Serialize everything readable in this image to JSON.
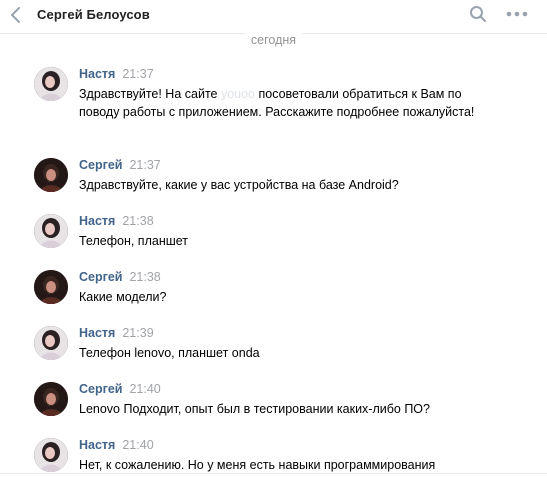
{
  "header": {
    "title": "Сергей Белоусов",
    "back_icon": "chevron-left-icon",
    "search_icon": "search-icon",
    "more_icon": "more-dots-icon"
  },
  "date_divider": "сегодня",
  "colors": {
    "author": "#42648b",
    "time": "#a0a3a8",
    "divider_text": "#939393",
    "border": "#e7e8ec"
  },
  "messages": [
    {
      "author": "Настя",
      "time": "21:37",
      "text_before": "Здравствуйте! На сайте ",
      "text_redacted": "youoo",
      "text_after": " посоветовали обратиться к Вам по поводу работы с приложением. Расскажите подробнее пожалуйста!"
    },
    {
      "author": "Сергей",
      "time": "21:37",
      "text": "Здравствуйте, какие у вас устройства на базе Android?"
    },
    {
      "author": "Настя",
      "time": "21:38",
      "text": "Телефон, планшет"
    },
    {
      "author": "Сергей",
      "time": "21:38",
      "text": "Какие модели?"
    },
    {
      "author": "Настя",
      "time": "21:39",
      "text": "Телефон lenovo, планшет onda"
    },
    {
      "author": "Сергей",
      "time": "21:40",
      "text": "Lenovo Подходит, опыт был в тестировании каких-либо ПО?"
    },
    {
      "author": "Настя",
      "time": "21:40",
      "text": "Нет, к сожалению. Но у меня есть навыки программирования"
    }
  ]
}
